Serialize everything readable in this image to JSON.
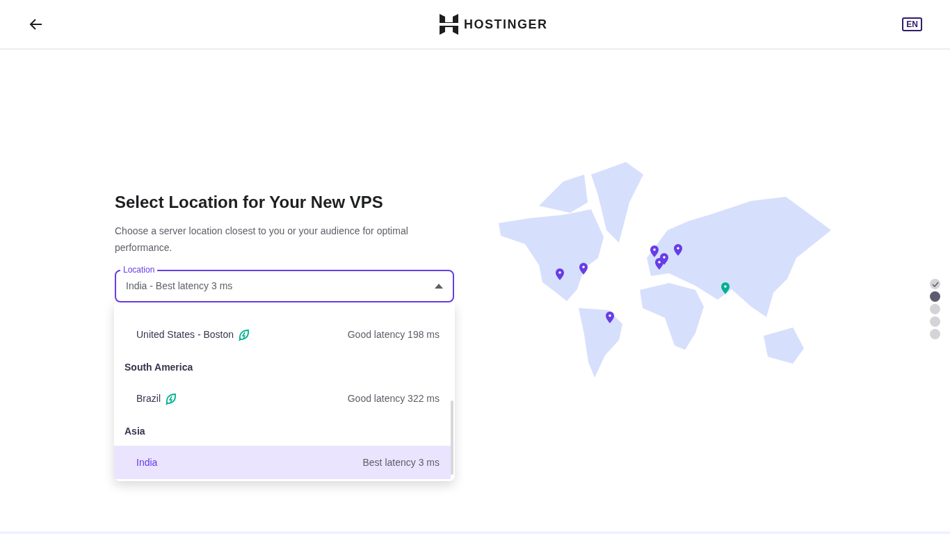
{
  "header": {
    "brand": "HOSTINGER",
    "language": "EN"
  },
  "heading": "Select Location for Your New VPS",
  "description": "Choose a server location closest to you or your audience for optimal performance.",
  "location_field": {
    "label": "Location",
    "value": "India - Best latency 3 ms",
    "expanded": true
  },
  "dropdown": [
    {
      "kind": "option",
      "name": "United States - Boston",
      "eco": true,
      "latency": "Good latency 198 ms",
      "selected": false
    },
    {
      "kind": "group",
      "name": "South America"
    },
    {
      "kind": "option",
      "name": "Brazil",
      "eco": true,
      "latency": "Good latency 322 ms",
      "selected": false
    },
    {
      "kind": "group",
      "name": "Asia"
    },
    {
      "kind": "option",
      "name": "India",
      "eco": false,
      "latency": "Best latency 3 ms",
      "selected": true
    }
  ],
  "map_pins": [
    {
      "selected": false
    },
    {
      "selected": false
    },
    {
      "selected": false
    },
    {
      "selected": false
    },
    {
      "selected": false
    },
    {
      "selected": false
    },
    {
      "selected": false
    },
    {
      "selected": true
    }
  ],
  "steps": [
    {
      "completed": true,
      "selected": false
    },
    {
      "completed": false,
      "selected": true
    },
    {
      "completed": false,
      "selected": false
    },
    {
      "completed": false,
      "selected": false
    },
    {
      "completed": false,
      "selected": false
    }
  ]
}
